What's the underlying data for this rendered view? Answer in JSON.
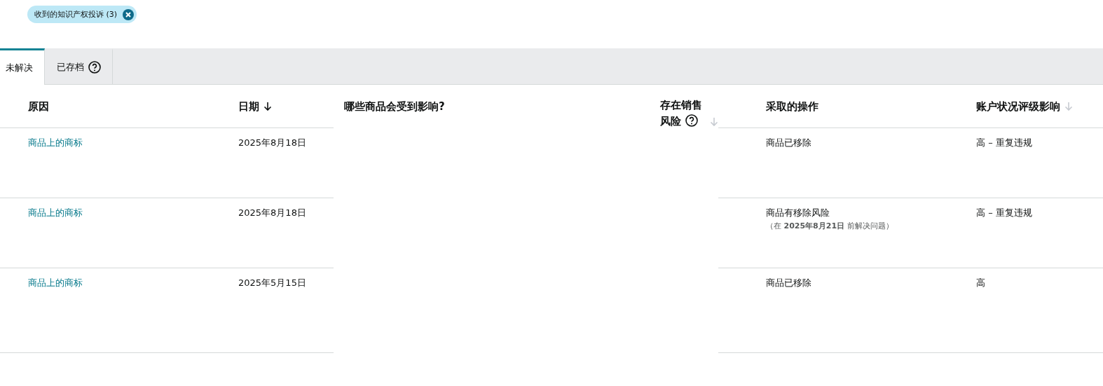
{
  "filter_chip": {
    "label": "收到的知识产权投诉 (3)"
  },
  "tabs": [
    {
      "label": "未解决",
      "selected": true
    },
    {
      "label": "已存档",
      "selected": false,
      "help": true
    }
  ],
  "table": {
    "columns": [
      {
        "label": "原因"
      },
      {
        "label": "日期",
        "sorted": true
      },
      {
        "label": "哪些商品会受到影响?"
      },
      {
        "label": "存在销售风险",
        "sorted": false,
        "help": true
      },
      {
        "label": "采取的操作"
      },
      {
        "label": "账户状况评级影响",
        "sorted": false
      }
    ],
    "rows": [
      {
        "reason": "商品上的商标",
        "date": "2025年8月18日",
        "action": "商品已移除",
        "impact": "高 – 重复违规"
      },
      {
        "reason": "商品上的商标",
        "date": "2025年8月18日",
        "action": "商品有移除风险",
        "action_note": "（在 **2025年8月21日** 前解决问题）",
        "impact": "高 – 重复违规"
      },
      {
        "reason": "商品上的商标",
        "date": "2025年5月15日",
        "action": "商品已移除",
        "impact": "高"
      }
    ]
  }
}
